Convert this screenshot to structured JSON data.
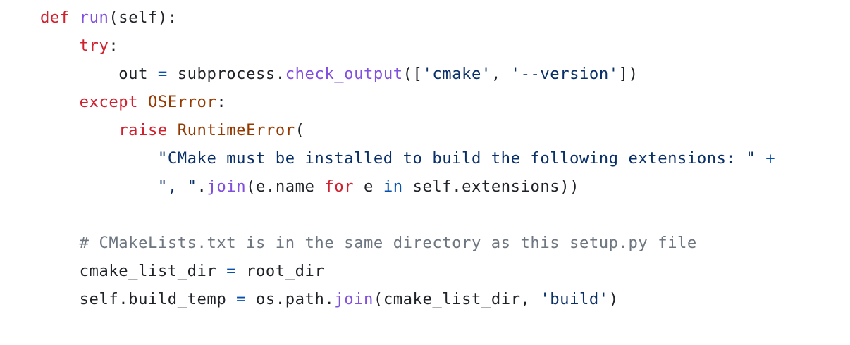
{
  "code": {
    "language": "python",
    "colors": {
      "keyword": "#cf222e",
      "function": "#8250df",
      "class": "#953800",
      "string": "#0a3069",
      "operator": "#0550ae",
      "comment": "#6e7781",
      "text": "#1f2328",
      "background": "#ffffff"
    },
    "lines": [
      [
        {
          "t": "kw",
          "v": "def"
        },
        {
          "t": "tx",
          "v": " "
        },
        {
          "t": "fn",
          "v": "run"
        },
        {
          "t": "tx",
          "v": "(self):"
        }
      ],
      [
        {
          "t": "tx",
          "v": "    "
        },
        {
          "t": "kw",
          "v": "try"
        },
        {
          "t": "tx",
          "v": ":"
        }
      ],
      [
        {
          "t": "tx",
          "v": "        out "
        },
        {
          "t": "op",
          "v": "="
        },
        {
          "t": "tx",
          "v": " subprocess."
        },
        {
          "t": "fn",
          "v": "check_output"
        },
        {
          "t": "tx",
          "v": "(["
        },
        {
          "t": "str",
          "v": "'cmake'"
        },
        {
          "t": "tx",
          "v": ", "
        },
        {
          "t": "str",
          "v": "'--version'"
        },
        {
          "t": "tx",
          "v": "])"
        }
      ],
      [
        {
          "t": "tx",
          "v": "    "
        },
        {
          "t": "kw",
          "v": "except"
        },
        {
          "t": "tx",
          "v": " "
        },
        {
          "t": "cls",
          "v": "OSError"
        },
        {
          "t": "tx",
          "v": ":"
        }
      ],
      [
        {
          "t": "tx",
          "v": "        "
        },
        {
          "t": "kw",
          "v": "raise"
        },
        {
          "t": "tx",
          "v": " "
        },
        {
          "t": "cls",
          "v": "RuntimeError"
        },
        {
          "t": "tx",
          "v": "("
        }
      ],
      [
        {
          "t": "tx",
          "v": "            "
        },
        {
          "t": "str",
          "v": "\"CMake must be installed to build the following extensions: \""
        },
        {
          "t": "tx",
          "v": " "
        },
        {
          "t": "op",
          "v": "+"
        }
      ],
      [
        {
          "t": "tx",
          "v": "            "
        },
        {
          "t": "str",
          "v": "\", \""
        },
        {
          "t": "tx",
          "v": "."
        },
        {
          "t": "fn",
          "v": "join"
        },
        {
          "t": "tx",
          "v": "(e.name "
        },
        {
          "t": "kw",
          "v": "for"
        },
        {
          "t": "tx",
          "v": " e "
        },
        {
          "t": "op",
          "v": "in"
        },
        {
          "t": "tx",
          "v": " self.extensions))"
        }
      ],
      [
        {
          "t": "tx",
          "v": ""
        }
      ],
      [
        {
          "t": "tx",
          "v": "    "
        },
        {
          "t": "cm",
          "v": "# CMakeLists.txt is in the same directory as this setup.py file"
        }
      ],
      [
        {
          "t": "tx",
          "v": "    cmake_list_dir "
        },
        {
          "t": "op",
          "v": "="
        },
        {
          "t": "tx",
          "v": " root_dir"
        }
      ],
      [
        {
          "t": "tx",
          "v": "    self.build_temp "
        },
        {
          "t": "op",
          "v": "="
        },
        {
          "t": "tx",
          "v": " os.path."
        },
        {
          "t": "fn",
          "v": "join"
        },
        {
          "t": "tx",
          "v": "(cmake_list_dir, "
        },
        {
          "t": "str",
          "v": "'build'"
        },
        {
          "t": "tx",
          "v": ")"
        }
      ]
    ]
  }
}
